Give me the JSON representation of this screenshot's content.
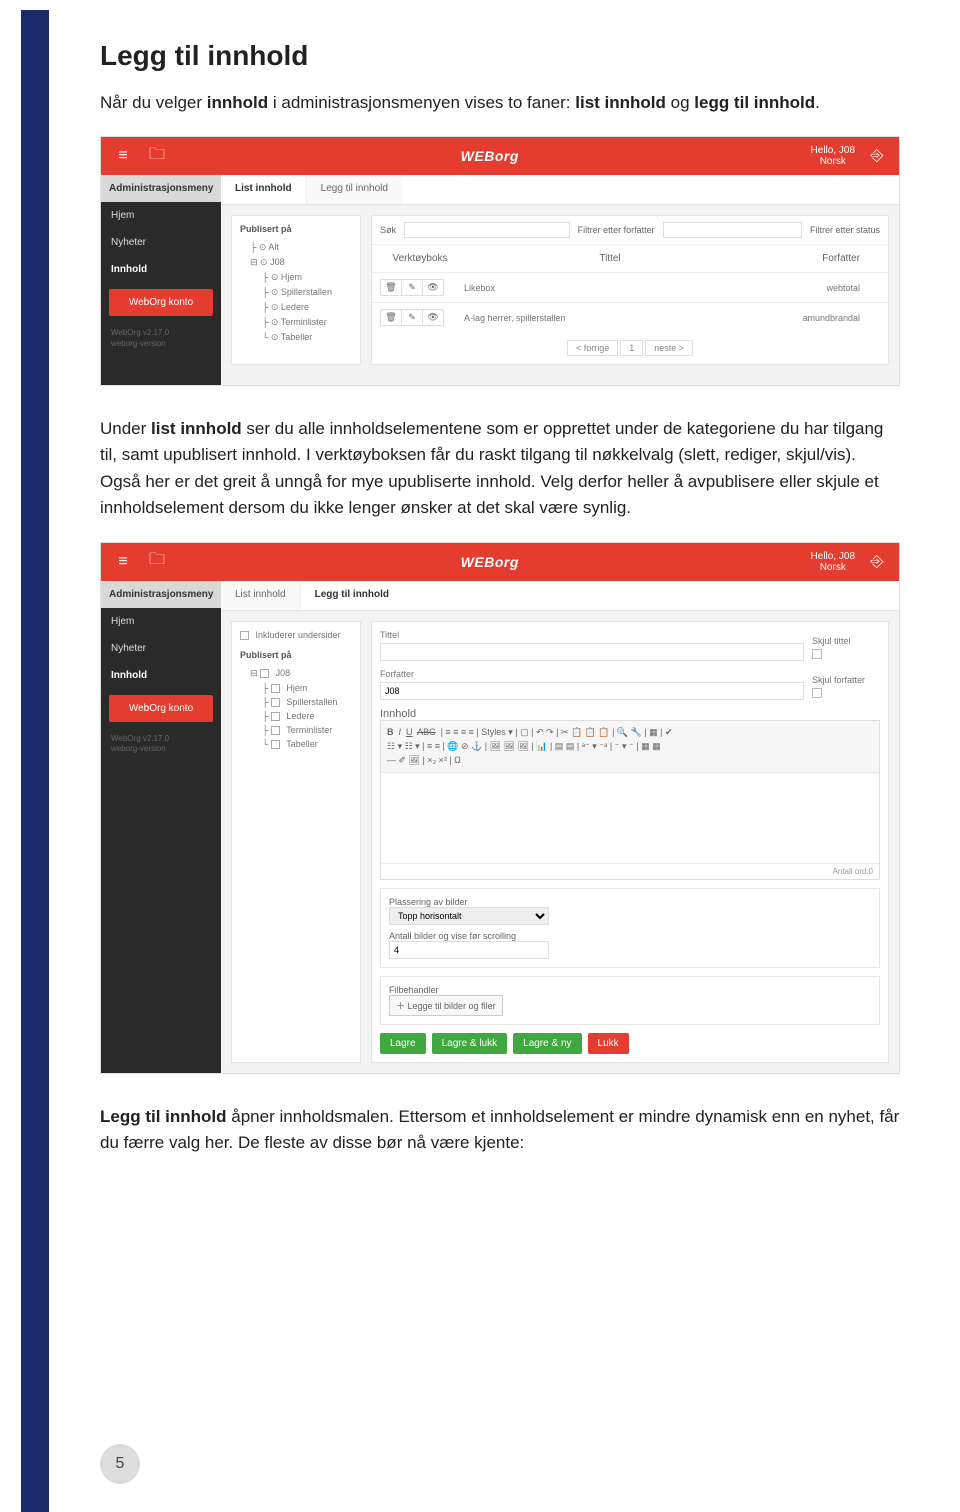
{
  "doc": {
    "page_badge": "5",
    "title": "Legg til innhold",
    "p1_a": "Når du velger ",
    "p1_b": "innhold",
    "p1_c": " i administrasjonsmenyen vises to faner: ",
    "p1_d": "list innhold",
    "p1_e": " og ",
    "p1_f": "legg til innhold",
    "p1_g": ".",
    "p2_a": "Under ",
    "p2_b": "list innhold",
    "p2_c": " ser du alle innholdselementene som er opprettet under de kategoriene du har tilgang til, samt upublisert innhold. I verktøyboksen får du raskt tilgang til nøkkelvalg (slett, rediger, skjul/vis). Også her er det greit å unngå for mye upubliserte innhold. Velg derfor heller å avpublisere eller skjule et innholdselement dersom du ikke lenger ønsker at det skal være synlig.",
    "p3_a": "Legg til innhold",
    "p3_b": " åpner innholdsmalen. Ettersom et innholdselement er mindre dynamisk enn en nyhet, får du færre valg her. De fleste av disse bør nå være kjente:"
  },
  "app": {
    "logo": "WEBorg",
    "greet_line1": "Hello, J08",
    "greet_line2": "Norsk",
    "admin_header": "Administrasjonsmeny",
    "menu": {
      "hjem": "Hjem",
      "nyheter": "Nyheter",
      "innhold": "Innhold",
      "konto": "WebOrg konto"
    },
    "version1": "WebOrg v2.17.0",
    "version2": "weborg-version"
  },
  "shot1": {
    "tabs": {
      "list": "List innhold",
      "legg": "Legg til innhold"
    },
    "tree_title": "Publisert på",
    "tree": {
      "alt": "Alt",
      "root": "J08",
      "hjem": "Hjem",
      "spill": "Spillerstallen",
      "ledere": "Ledere",
      "term": "Terminlister",
      "tab": "Tabeller"
    },
    "filters": {
      "sok": "Søk",
      "forf": "Filtrer etter forfatter",
      "status": "Filtrer etter status"
    },
    "cols": {
      "c1": "Verktøyboks",
      "c2": "Tittel",
      "c3": "Forfatter"
    },
    "rows": [
      {
        "title": "Likebox",
        "author": "webtotal"
      },
      {
        "title": "A-lag herrer, spillerstallen",
        "author": "amundbrandal"
      }
    ],
    "pager": {
      "prev": "< forrige",
      "page": "1",
      "next": "neste >"
    }
  },
  "shot2": {
    "tabs": {
      "list": "List innhold",
      "legg": "Legg til innhold"
    },
    "inkl": "Inkluderer undersider",
    "tree_title": "Publisert på",
    "tree": {
      "root": "J08",
      "hjem": "Hjem",
      "spill": "Spillerstallen",
      "ledere": "Ledere",
      "term": "Terminlister",
      "tab": "Tabeller"
    },
    "form": {
      "tittel": "Tittel",
      "skjul_t": "Skjul tittel",
      "forfatter": "Forfatter",
      "forfatter_val": "J08",
      "skjul_f": "Skjul forfatter",
      "innhold": "Innhold",
      "styles": "Styles",
      "ord": "Antall ord:0",
      "plass": "Plassering av bilder",
      "plass_val": "Topp horisontalt",
      "antall": "Antall bilder og vise før scrolling",
      "antall_val": "4",
      "filb": "Filbehandler",
      "filb_btn": "Legge til bilder og filer"
    },
    "btns": {
      "lagre": "Lagre",
      "lukk": "Lagre & lukk",
      "ny": "Lagre & ny",
      "avbryt": "Lukk"
    }
  }
}
